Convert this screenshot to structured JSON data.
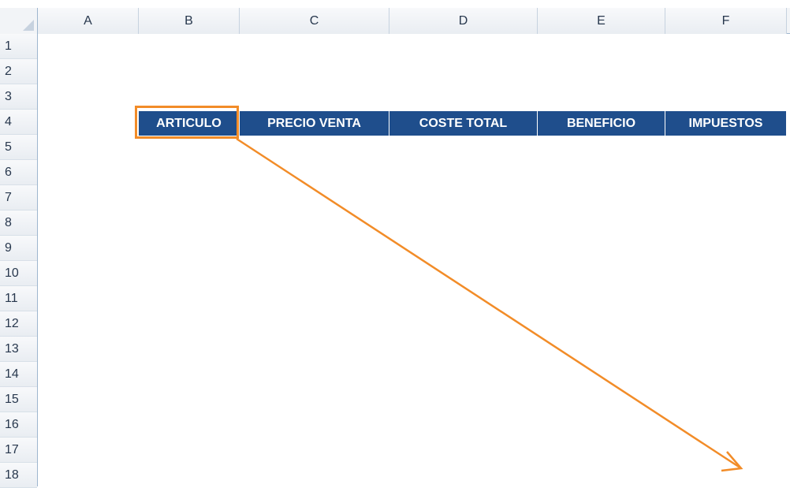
{
  "columns": [
    "A",
    "B",
    "C",
    "D",
    "E",
    "F"
  ],
  "rows": [
    "1",
    "2",
    "3",
    "4",
    "5",
    "6",
    "7",
    "8",
    "9",
    "10",
    "11",
    "12",
    "13",
    "14",
    "15",
    "16",
    "17",
    "18"
  ],
  "table_header": {
    "articulo": "ARTICULO",
    "precio_venta": "PRECIO VENTA",
    "coste_total": "COSTE TOTAL",
    "beneficio": "BENEFICIO",
    "impuestos": "IMPUESTOS"
  },
  "colors": {
    "header_fill": "#1f4e8c",
    "header_text": "#ffffff",
    "highlight": "#f28c28"
  }
}
